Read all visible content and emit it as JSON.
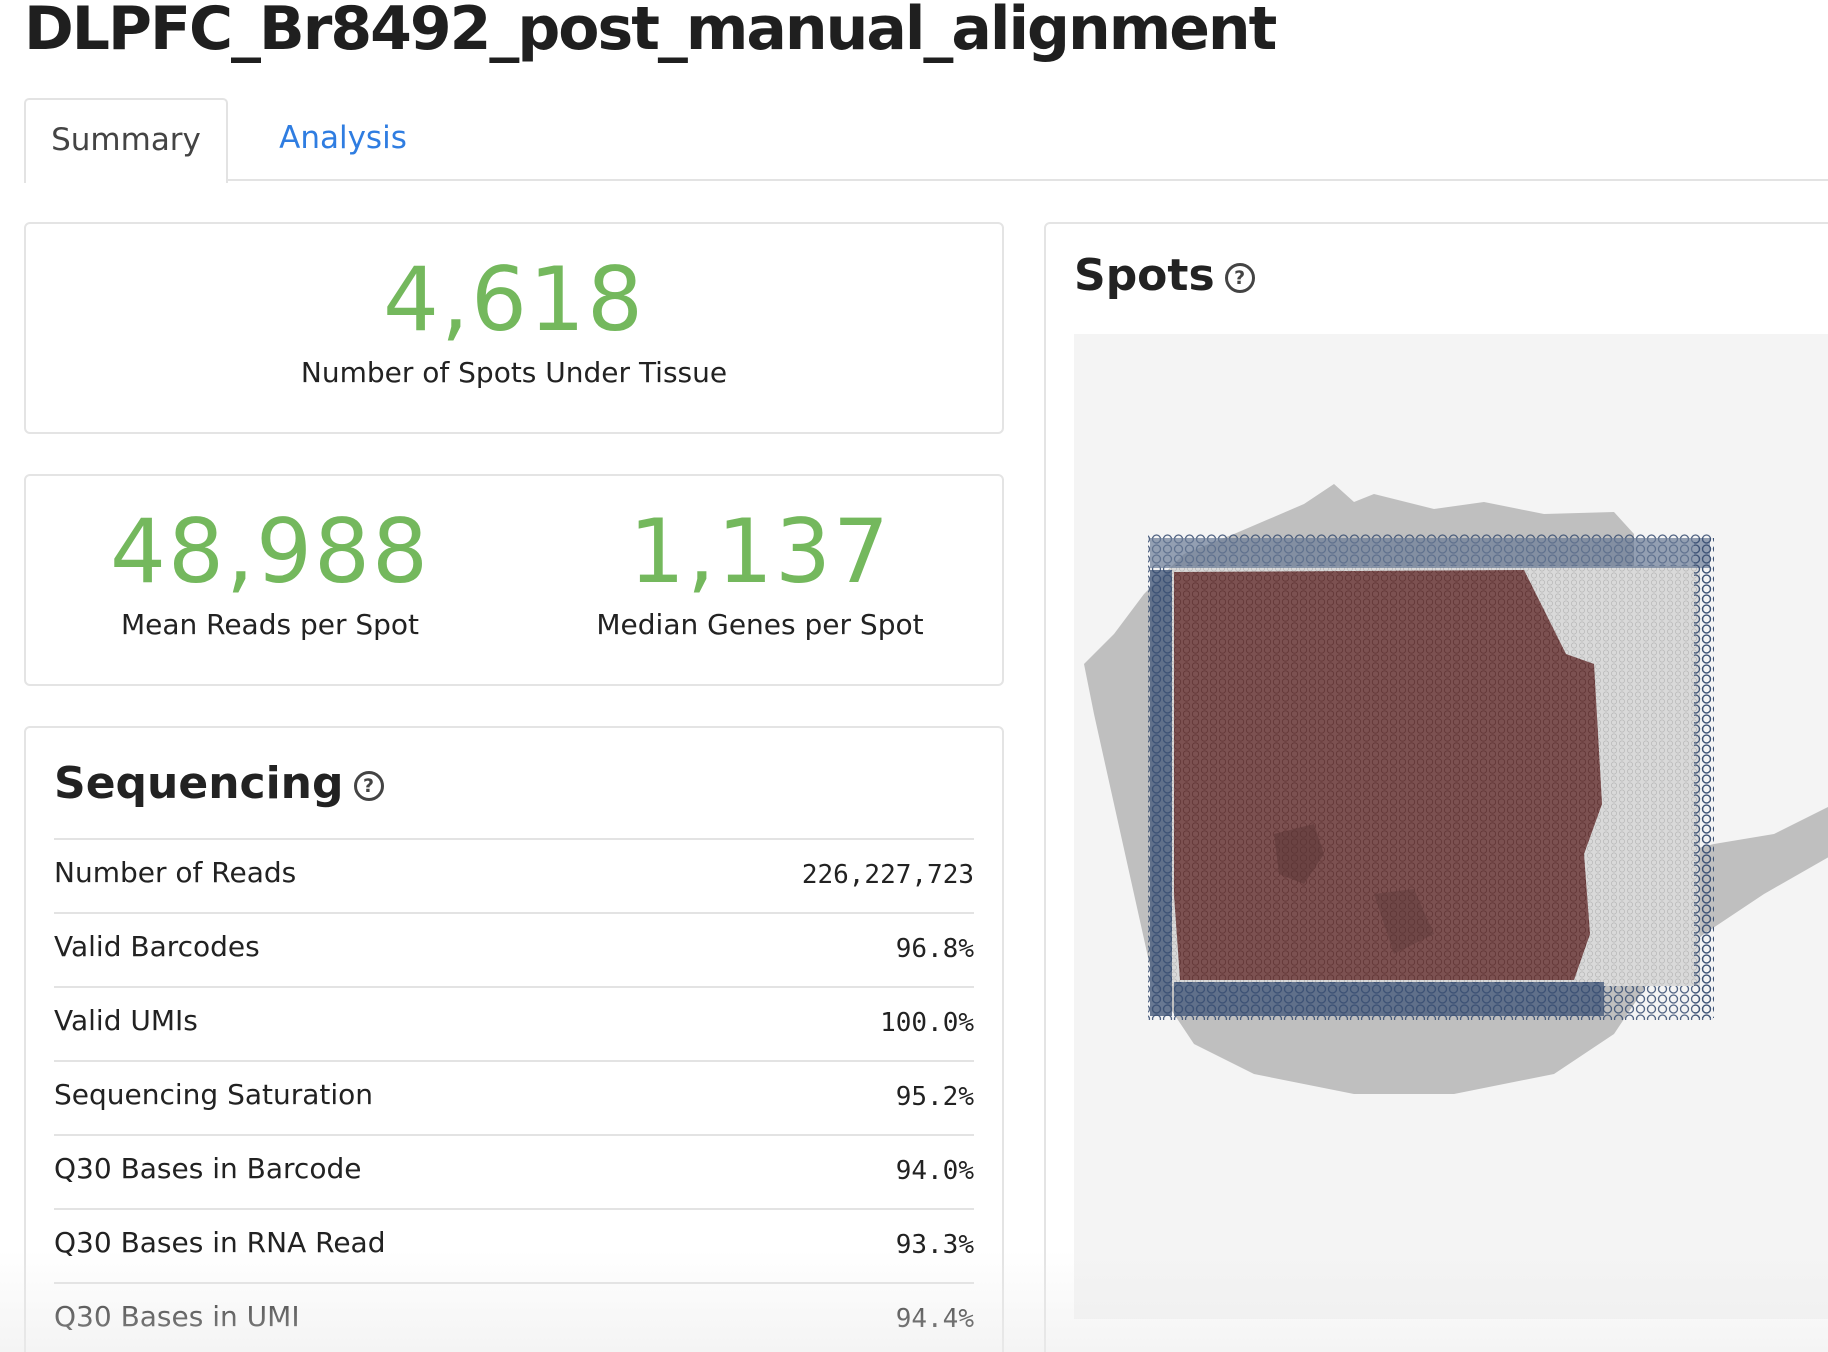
{
  "page_title": "DLPFC_Br8492_post_manual_alignment",
  "tabs": [
    {
      "label": "Summary",
      "active": true
    },
    {
      "label": "Analysis",
      "active": false
    }
  ],
  "metrics": {
    "spots_under_tissue": {
      "value": "4,618",
      "label": "Number of Spots Under Tissue"
    },
    "mean_reads": {
      "value": "48,988",
      "label": "Mean Reads per Spot"
    },
    "median_genes": {
      "value": "1,137",
      "label": "Median Genes per Spot"
    }
  },
  "sequencing": {
    "title": "Sequencing",
    "help": "?",
    "rows": [
      {
        "label": "Number of Reads",
        "value": "226,227,723"
      },
      {
        "label": "Valid Barcodes",
        "value": "96.8%"
      },
      {
        "label": "Valid UMIs",
        "value": "100.0%"
      },
      {
        "label": "Sequencing Saturation",
        "value": "95.2%"
      },
      {
        "label": "Q30 Bases in Barcode",
        "value": "94.0%"
      },
      {
        "label": "Q30 Bases in RNA Read",
        "value": "93.3%"
      },
      {
        "label": "Q30 Bases in UMI",
        "value": "94.4%"
      }
    ]
  },
  "spots": {
    "title": "Spots",
    "help": "?"
  },
  "colors": {
    "metric_green": "#74b85d",
    "link_blue": "#2f7de1",
    "tissue_spots": "#7a4a4a",
    "background_spots": "#5a6c8a"
  }
}
